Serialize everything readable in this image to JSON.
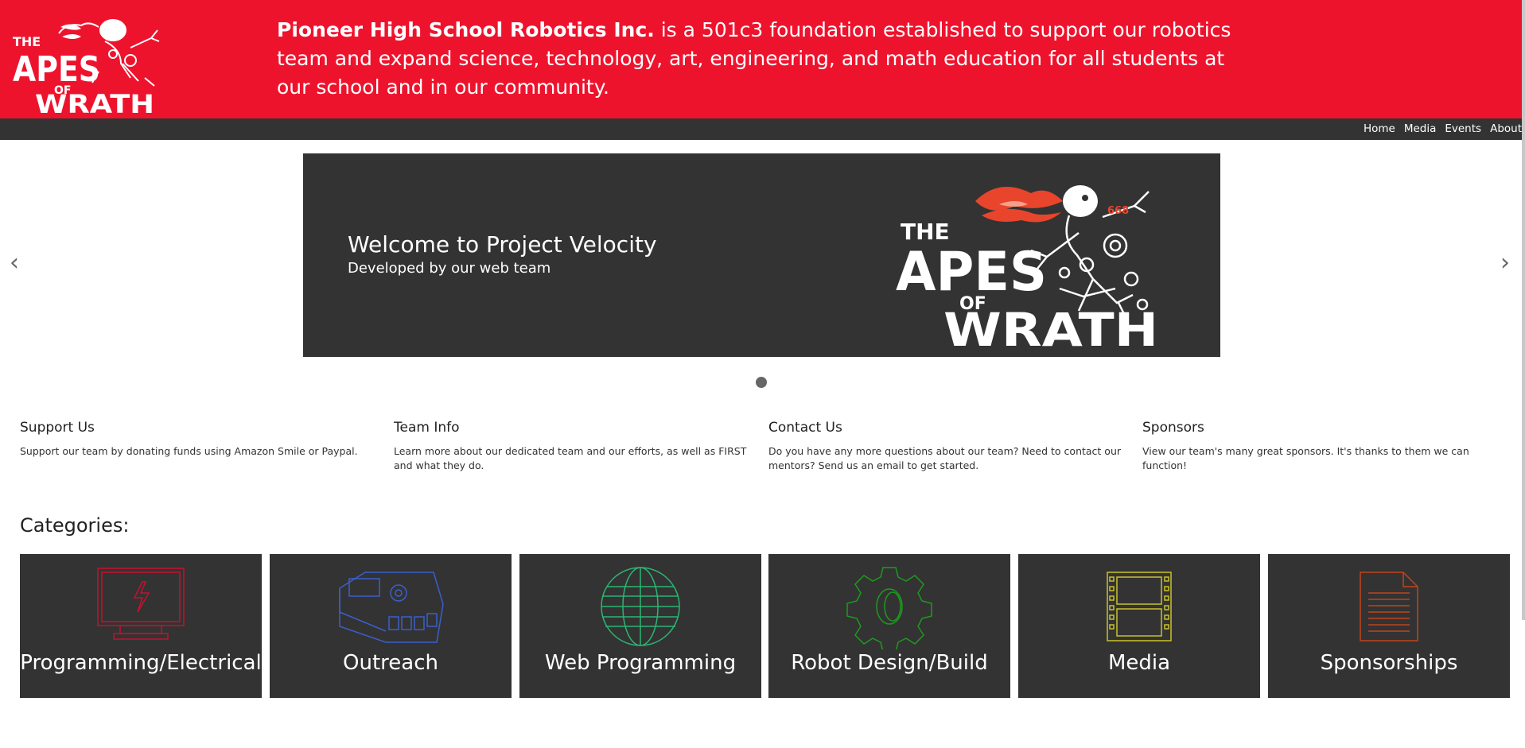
{
  "header": {
    "logo_text": [
      "THE",
      "APES",
      "OF",
      "WRATH"
    ],
    "org_name": "Pioneer High School Robotics Inc.",
    "mission_rest": " is a 501c3 foundation established to support our robotics team and expand science, technology, art, engineering, and math education for all students at our school and in our community.",
    "brand_color": "#ee132d"
  },
  "nav": {
    "items": [
      {
        "label": "Home"
      },
      {
        "label": "Media"
      },
      {
        "label": "Events"
      },
      {
        "label": "About"
      }
    ]
  },
  "carousel": {
    "prev_glyph": "‹",
    "next_glyph": "›",
    "slides": [
      {
        "title": "Welcome to Project Velocity",
        "subtitle": "Developed by our web team",
        "logo_text": [
          "THE",
          "APES",
          "OF",
          "WRATH"
        ],
        "badge": "668"
      }
    ],
    "active_index": 0
  },
  "info": [
    {
      "title": "Support Us",
      "text": "Support our team by donating funds using Amazon Smile or Paypal."
    },
    {
      "title": "Team Info",
      "text": "Learn more about our dedicated team and our efforts, as well as FIRST and what they do."
    },
    {
      "title": "Contact Us",
      "text": "Do you have any more questions about our team? Need to contact our mentors? Send us an email to get started."
    },
    {
      "title": "Sponsors",
      "text": "View our team's many great sponsors. It's thanks to them we can function!"
    }
  ],
  "categories": {
    "heading": "Categories:",
    "items": [
      {
        "label": "Programming/Electrical",
        "icon": "monitor-bolt-icon",
        "color": "#c8102e"
      },
      {
        "label": "Outreach",
        "icon": "controller-brick-icon",
        "color": "#3a5fcd"
      },
      {
        "label": "Web Programming",
        "icon": "globe-icon",
        "color": "#2bb673"
      },
      {
        "label": "Robot Design/Build",
        "icon": "gear-icon",
        "color": "#1e9a1e"
      },
      {
        "label": "Media",
        "icon": "film-strip-icon",
        "color": "#c9c12a"
      },
      {
        "label": "Sponsorships",
        "icon": "document-icon",
        "color": "#c0441e"
      }
    ]
  }
}
